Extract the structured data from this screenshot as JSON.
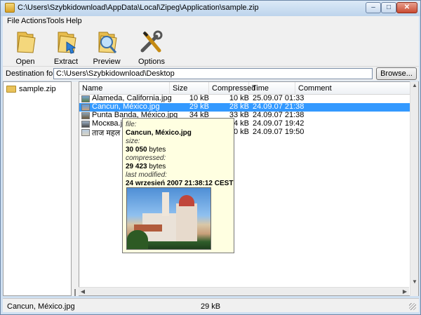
{
  "window": {
    "title": "C:\\Users\\Szybkidownload\\AppData\\Local\\Zipeg\\Application\\sample.zip",
    "controls": {
      "minimize": "–",
      "maximize": "□",
      "close": "✕"
    }
  },
  "menu": [
    "File",
    "Actions",
    "Tools",
    "Help"
  ],
  "toolbar": [
    {
      "label": "Open",
      "icon": "open-folder-icon"
    },
    {
      "label": "Extract",
      "icon": "extract-folder-icon"
    },
    {
      "label": "Preview",
      "icon": "preview-magnifier-icon"
    },
    {
      "label": "Options",
      "icon": "options-tools-icon"
    }
  ],
  "destination": {
    "label": "Destination folder:",
    "value": "C:\\Users\\Szybkidownload\\Desktop",
    "browse_label": "Browse..."
  },
  "tree": {
    "items": [
      {
        "label": "sample.zip",
        "icon": "folder-icon"
      }
    ]
  },
  "list": {
    "columns": [
      "Name",
      "Size",
      "Compressed",
      "Time",
      "Comment"
    ],
    "rows": [
      {
        "name": "Alameda, California.jpg",
        "size": "10 kB",
        "compressed": "10 kB",
        "time": "25.09.07 01:33",
        "comment": "",
        "selected": false
      },
      {
        "name": "Cancun, México.jpg",
        "size": "29 kB",
        "compressed": "28 kB",
        "time": "24.09.07 21:38",
        "comment": "",
        "selected": true
      },
      {
        "name": "Punta Banda, México.jpg",
        "size": "34 kB",
        "compressed": "33 kB",
        "time": "24.09.07 21:38",
        "comment": "",
        "selected": false
      },
      {
        "name": "Москва.jpg",
        "size": "",
        "compressed": "4 kB",
        "time": "24.09.07 19:42",
        "comment": "",
        "selected": false
      },
      {
        "name": "ताज महल تاج محل",
        "size": "",
        "compressed": "10 kB",
        "time": "24.09.07 19:50",
        "comment": "",
        "selected": false
      }
    ]
  },
  "tooltip": {
    "file_key": "file:",
    "file_val": "Cancun, México.jpg",
    "size_key": "size:",
    "size_val": "30 050",
    "size_unit": "bytes",
    "compressed_key": "compressed:",
    "compressed_val": "29 423",
    "compressed_unit": "bytes",
    "modified_key": "last modified:",
    "modified_val": "24 wrzesień 2007 21:38:12 CEST"
  },
  "status": {
    "name": "Cancun, México.jpg",
    "size": "29 kB"
  },
  "colors": {
    "selection": "#3399ff",
    "tooltip_bg": "#ffffe1",
    "window_frame": "#cfe0f2"
  }
}
